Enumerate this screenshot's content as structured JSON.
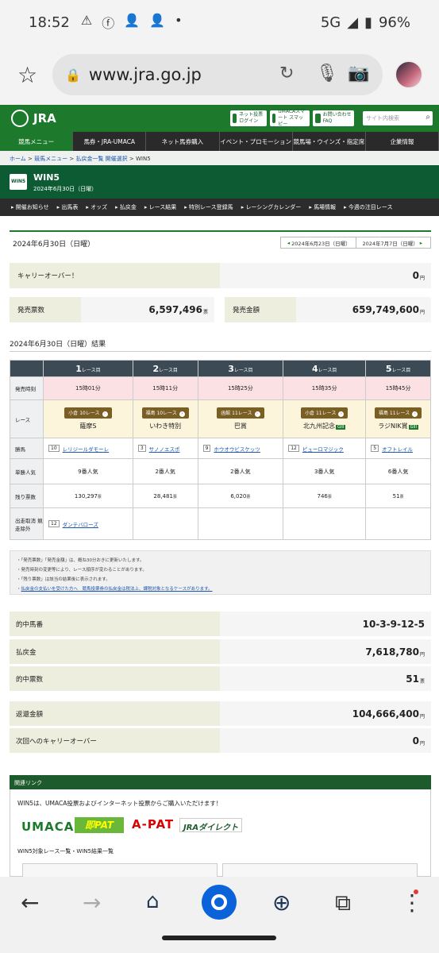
{
  "status_bar": {
    "time": "18:52",
    "network": "5G",
    "battery": "96%"
  },
  "browser": {
    "url": "www.jra.go.jp"
  },
  "header": {
    "logo": "JRA",
    "btn_netvote": "ネット投票 ログイン",
    "btn_umaca": "UMACAスマート スマッピー",
    "btn_faq": "お問い合わせ FAQ",
    "search_placeholder": "サイト内検索"
  },
  "main_nav": [
    "競馬メニュー",
    "馬券・JRA-UMACA",
    "ネット馬券購入",
    "イベント・プロモーション",
    "競馬場・ウインズ・指定席",
    "企業情報"
  ],
  "breadcrumb": {
    "home": "ホーム",
    "menu": "競馬メニュー",
    "list": "払戻金一覧 開催選択",
    "current": "WIN5"
  },
  "page": {
    "logo": "WIN5",
    "title": "WIN5",
    "date": "2024年6月30日（日曜）"
  },
  "sub_nav": [
    "開催お知らせ",
    "出馬表",
    "オッズ",
    "払戻金",
    "レース結果",
    "特別レース登録馬",
    "レーシングカレンダー",
    "馬場情報",
    "今週の注目レース"
  ],
  "content": {
    "date_label": "2024年6月30日（日曜）",
    "prev_date": "2024年6月23日（日曜）",
    "next_date": "2024年7月7日（日曜）",
    "carryover_label": "キャリーオーバー！",
    "carryover_value": "0",
    "sales_count_label": "発売票数",
    "sales_count_value": "6,597,496",
    "sales_amount_label": "発売金額",
    "sales_amount_value": "659,749,600",
    "yen": "円",
    "hyo": "票",
    "result_header": "2024年6月30日（日曜）結果"
  },
  "race_table": {
    "row_labels": {
      "time": "発売時刻",
      "race": "レース",
      "winner": "勝馬",
      "popularity": "単勝人気",
      "remaining": "残り票数",
      "scratch": "出走取消 競走除外"
    },
    "race_unit": "レース目",
    "races": [
      {
        "no": "1",
        "time": "15時01分",
        "venue": "小倉 10レース",
        "name": "薩摩S",
        "grade": "",
        "horse_no": "10",
        "horse": "レリジールダモーレ",
        "pop": "9番人気",
        "remaining": "130,297"
      },
      {
        "no": "2",
        "time": "15時11分",
        "venue": "福島 10レース",
        "name": "いわき特別",
        "grade": "",
        "horse_no": "3",
        "horse": "サノノエスポ",
        "pop": "2番人気",
        "remaining": "28,481"
      },
      {
        "no": "3",
        "time": "15時25分",
        "venue": "函館 11レース",
        "name": "巴賞",
        "grade": "",
        "horse_no": "9",
        "horse": "ホウオウビスケッツ",
        "pop": "2番人気",
        "remaining": "6,020"
      },
      {
        "no": "4",
        "time": "15時35分",
        "venue": "小倉 11レース",
        "name": "北九州記念",
        "grade": "GIII",
        "horse_no": "12",
        "horse": "ピューロマジック",
        "pop": "3番人気",
        "remaining": "746"
      },
      {
        "no": "5",
        "time": "15時45分",
        "venue": "福島 11レース",
        "name": "ラジNIK賞",
        "grade": "GIII",
        "horse_no": "5",
        "horse": "オフトレイル",
        "pop": "6番人気",
        "remaining": "51"
      }
    ],
    "scratch": {
      "no": "12",
      "horse": "ダンテバローズ"
    }
  },
  "notes": [
    "「発売票数」「発売金額」は、概ね30分おきに更新いたします。",
    "発売時刻の変更等により、レース順序が変わることがあります。",
    "「残り票数」は該当の結果後に表示されます。",
    "払戻金の支払いを受けた方へ　競馬投票券の払戻金は税法上、課税対象となるケースがあります。"
  ],
  "results": {
    "winning_label": "的中馬番",
    "winning_value": "10-3-9-12-5",
    "payout_label": "払戻金",
    "payout_value": "7,618,780",
    "hits_label": "的中票数",
    "hits_value": "51",
    "refund_label": "返還金額",
    "refund_value": "104,666,400",
    "next_carry_label": "次回へのキャリーオーバー",
    "next_carry_value": "0"
  },
  "related": {
    "header": "関連リンク",
    "text": "WIN5は、UMACA投票およびインターネット投票からご購入いただけます！",
    "logos": [
      "UMACA",
      "即PAT",
      "A-PAT",
      "JRAダイレクト"
    ],
    "list_label": "WIN5対象レース一覧・WIN5結果一覧"
  }
}
